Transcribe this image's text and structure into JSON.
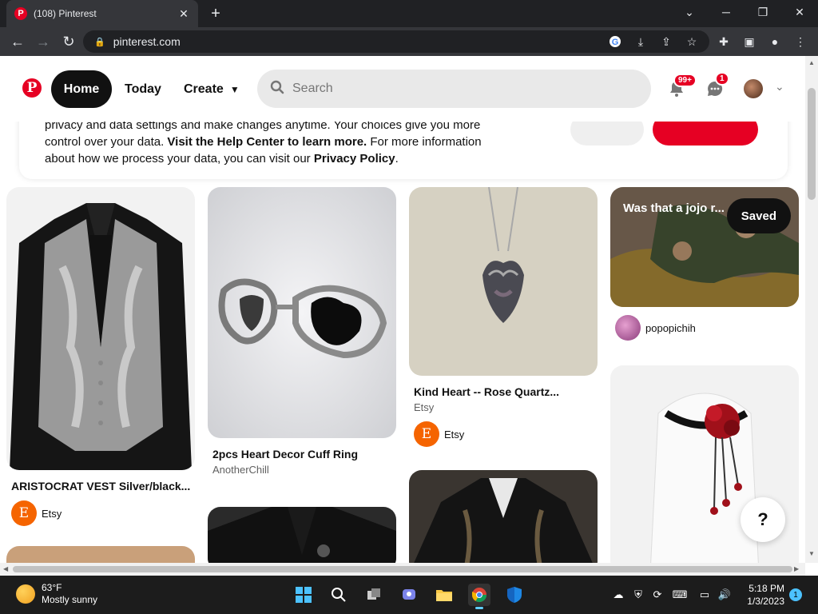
{
  "browser": {
    "tab_title": "(108) Pinterest",
    "tab_favicon": "P",
    "url": "pinterest.com",
    "new_tab_symbol": "+",
    "close_symbol": "✕"
  },
  "header": {
    "logo": "P",
    "home_label": "Home",
    "today_label": "Today",
    "create_label": "Create",
    "search_placeholder": "Search",
    "notifications_badge": "99+",
    "messages_badge": "1"
  },
  "consent": {
    "line1": "privacy and data settings and make changes anytime. Your choices give you more",
    "line2_a": "control over your data. ",
    "line2_bold": "Visit the Help Center to learn more.",
    "line2_b": " For more information",
    "line3_a": "about how we process your data, you can visit our ",
    "line3_bold": "Privacy Policy",
    "line3_b": "."
  },
  "pins": [
    {
      "title": "ARISTOCRAT VEST Silver/black...",
      "owner": "Etsy",
      "owner_initial": "E"
    },
    {
      "title": "2pcs Heart Decor Cuff Ring",
      "subtitle": "AnotherChill"
    },
    {
      "title": "Kind Heart -- Rose Quartz...",
      "subtitle": "Etsy",
      "owner": "Etsy",
      "owner_initial": "E"
    },
    {
      "overlay_title": "Was that a jojo r...",
      "saved_label": "Saved",
      "owner": "popopichih"
    }
  ],
  "help_label": "?",
  "taskbar": {
    "temp": "63°F",
    "condition": "Mostly sunny",
    "time": "5:18 PM",
    "date": "1/3/2023",
    "notification_count": "1"
  },
  "colors": {
    "pinterest_red": "#e60023",
    "etsy_orange": "#f56400"
  }
}
